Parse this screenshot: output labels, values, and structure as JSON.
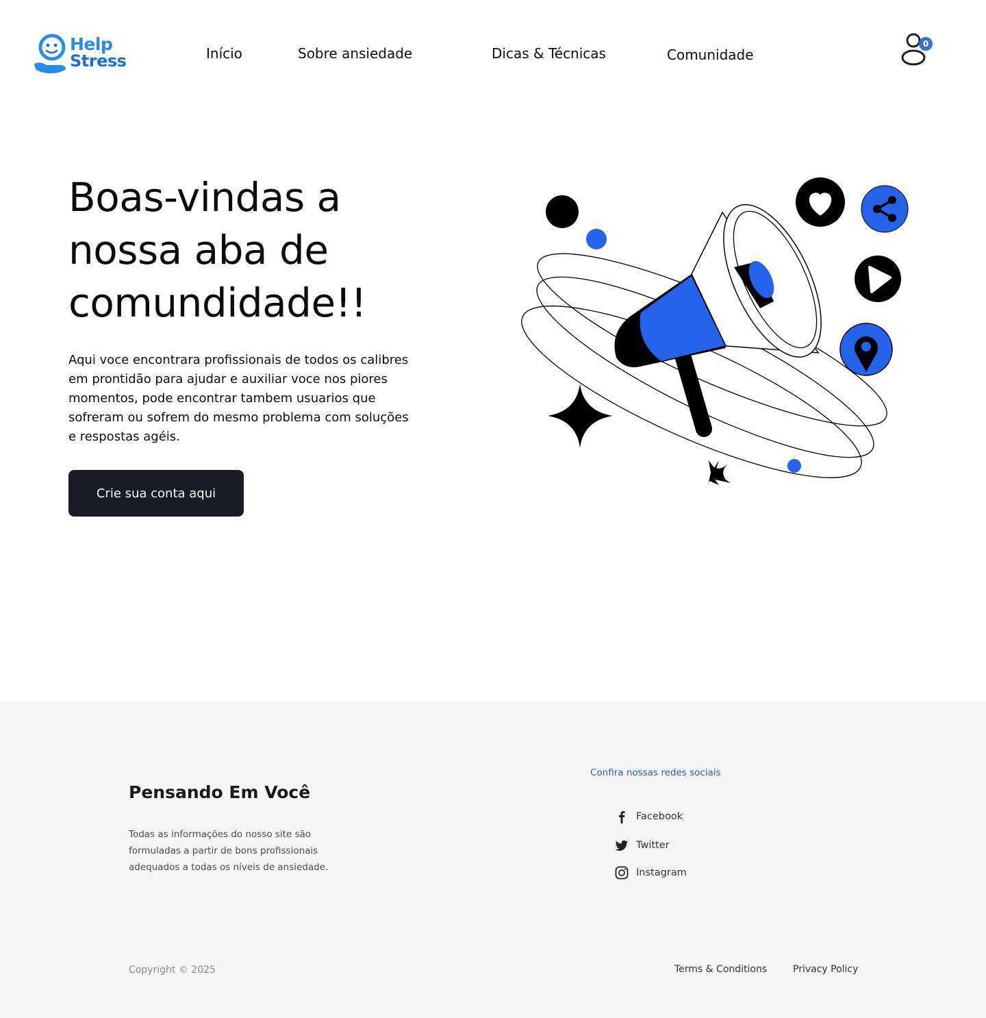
{
  "brand": {
    "logo_line1": "Help",
    "logo_line2": "Stress",
    "color_primary": "#2a8ce8",
    "color_accent": "#2563eb"
  },
  "nav": {
    "items": [
      {
        "label": "Início"
      },
      {
        "label": "Sobre ansiedade"
      },
      {
        "label": "Dicas & Técnicas"
      },
      {
        "label": "Comunidade"
      }
    ],
    "user_icon": "user-icon",
    "cart_count": "0"
  },
  "hero": {
    "title": "Boas-vindas a nossa aba de comundidade!!",
    "description": "Aqui voce encontrara profissionais de todos os calibres em prontidão para ajudar e auxiliar voce nos piores momentos, pode encontrar tambem usuarios que sofreram ou sofrem do mesmo problema com soluções e respostas agéis.",
    "cta_label": "Crie sua conta aqui",
    "illustration_icons": [
      "megaphone-icon",
      "heart-icon",
      "share-icon",
      "play-icon",
      "location-pin-icon",
      "sparkle-icon"
    ]
  },
  "footer": {
    "title": "Pensando Em Você",
    "description": "Todas as informações do nosso site são formuladas a partir de bons profissionais adequados a todas os níveis de ansiedade.",
    "social_title": "Confira nossas redes sociais",
    "social": [
      {
        "label": "Facebook",
        "icon": "facebook-icon"
      },
      {
        "label": "Twitter",
        "icon": "twitter-icon"
      },
      {
        "label": "Instagram",
        "icon": "instagram-icon"
      }
    ],
    "copyright": "Copyright © 2025",
    "terms": "Terms & Conditions",
    "privacy": "Privacy Policy"
  }
}
